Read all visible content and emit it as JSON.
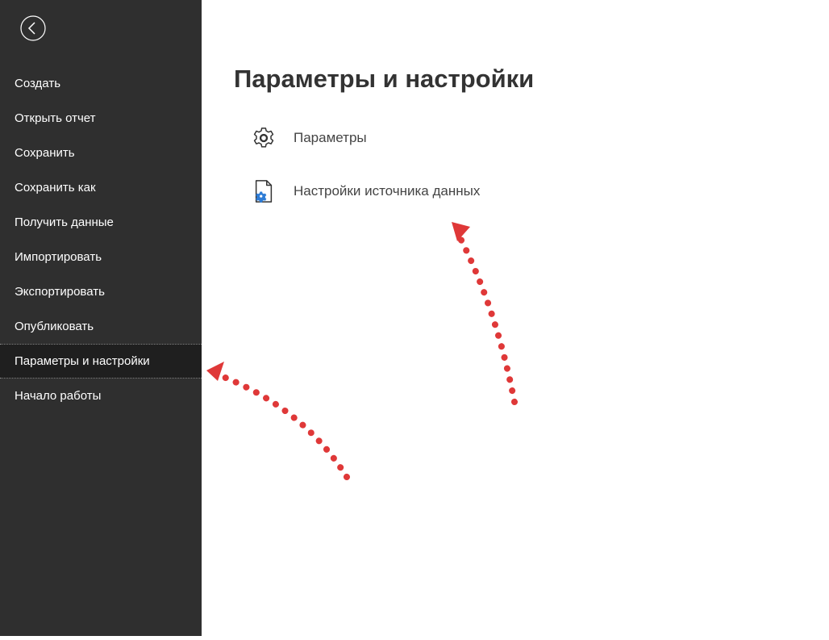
{
  "sidebar": {
    "items": [
      {
        "label": "Создать"
      },
      {
        "label": "Открыть отчет"
      },
      {
        "label": "Сохранить"
      },
      {
        "label": "Сохранить как"
      },
      {
        "label": "Получить данные"
      },
      {
        "label": "Импортировать"
      },
      {
        "label": "Экспортировать"
      },
      {
        "label": "Опубликовать"
      },
      {
        "label": "Параметры и настройки"
      },
      {
        "label": "Начало работы"
      }
    ],
    "selected_index": 8
  },
  "main": {
    "title": "Параметры и настройки",
    "options": [
      {
        "label": "Параметры",
        "icon": "gear-icon"
      },
      {
        "label": "Настройки источника данных",
        "icon": "file-gear-icon"
      }
    ]
  },
  "colors": {
    "sidebar_bg": "#2f2f2f",
    "sidebar_selected": "#1f1f1f",
    "annotation": "#df3838"
  }
}
